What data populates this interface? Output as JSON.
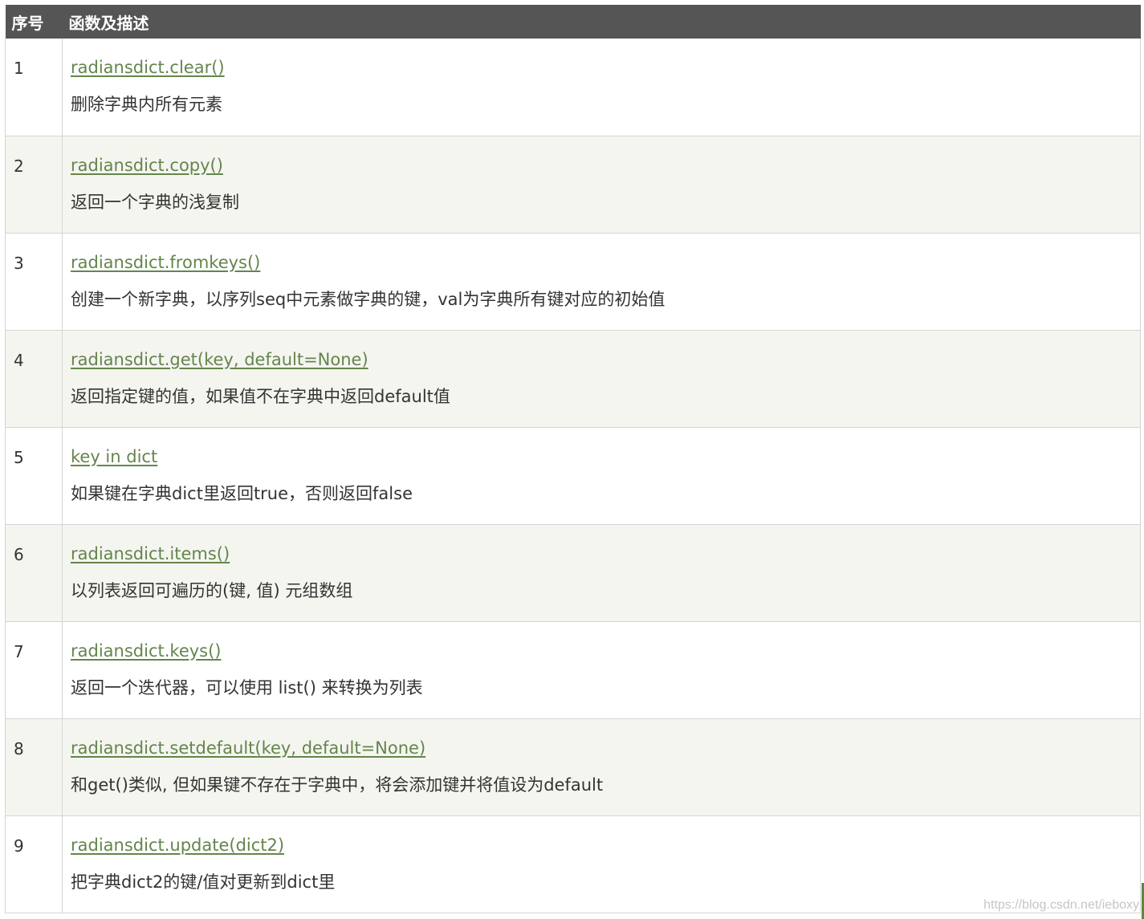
{
  "table": {
    "headers": [
      "序号",
      "函数及描述"
    ],
    "rows": [
      {
        "num": "1",
        "func": "radiansdict.clear()",
        "desc": "删除字典内所有元素"
      },
      {
        "num": "2",
        "func": "radiansdict.copy()",
        "desc": "返回一个字典的浅复制"
      },
      {
        "num": "3",
        "func": "radiansdict.fromkeys()",
        "desc": "创建一个新字典，以序列seq中元素做字典的键，val为字典所有键对应的初始值"
      },
      {
        "num": "4",
        "func": "radiansdict.get(key, default=None)",
        "desc": "返回指定键的值，如果值不在字典中返回default值"
      },
      {
        "num": "5",
        "func": "key in dict",
        "desc": "如果键在字典dict里返回true，否则返回false"
      },
      {
        "num": "6",
        "func": "radiansdict.items()",
        "desc": "以列表返回可遍历的(键, 值) 元组数组"
      },
      {
        "num": "7",
        "func": "radiansdict.keys()",
        "desc": "返回一个迭代器，可以使用 list() 来转换为列表"
      },
      {
        "num": "8",
        "func": "radiansdict.setdefault(key, default=None)",
        "desc": "和get()类似, 但如果键不存在于字典中，将会添加键并将值设为default"
      },
      {
        "num": "9",
        "func": "radiansdict.update(dict2)",
        "desc": "把字典dict2的键/值对更新到dict里"
      }
    ]
  },
  "watermark": "https://blog.csdn.net/ieboxy",
  "colors": {
    "header_bg": "#555555",
    "link": "#64854c",
    "row_alt": "#f5f5f0",
    "border": "#d4d4d4"
  }
}
